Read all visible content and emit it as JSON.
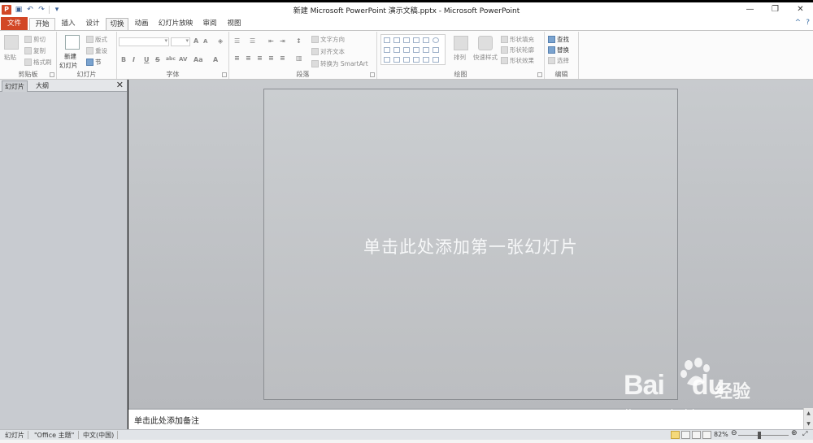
{
  "app": {
    "title": "新建 Microsoft PowerPoint 演示文稿.pptx - Microsoft PowerPoint",
    "icon_letter": "P"
  },
  "window_controls": {
    "minimize": "—",
    "maximize": "❐",
    "close": "✕"
  },
  "quick_access": {
    "save_icon": "save-icon",
    "undo_icon": "undo-icon",
    "redo_icon": "redo-icon"
  },
  "tabs": [
    "文件",
    "开始",
    "插入",
    "设计",
    "切换",
    "动画",
    "幻灯片放映",
    "审阅",
    "视图"
  ],
  "ribbon": {
    "clipboard": {
      "label": "剪贴板",
      "paste": "粘贴",
      "cut": "剪切",
      "copy": "复制",
      "format_painter": "格式刷"
    },
    "slides": {
      "label": "幻灯片",
      "new_slide_1": "新建",
      "new_slide_2": "幻灯片",
      "layout": "版式",
      "reset": "重设",
      "section": "节"
    },
    "font": {
      "label": "字体",
      "bold": "B",
      "italic": "I",
      "underline": "U",
      "strike": "S",
      "shadow": "abc",
      "spacing": "AV",
      "case": "Aa",
      "color": "A",
      "grow": "A",
      "shrink": "A"
    },
    "paragraph": {
      "label": "段落",
      "text_direction": "文字方向",
      "align_text": "对齐文本",
      "smartart": "转换为 SmartArt"
    },
    "drawing": {
      "label": "绘图",
      "arrange": "排列",
      "quick_styles": "快速样式",
      "shape_fill": "形状填充",
      "shape_outline": "形状轮廓",
      "shape_effects": "形状效果"
    },
    "editing": {
      "label": "编辑",
      "find": "查找",
      "replace": "替换",
      "select": "选择"
    }
  },
  "left_panel": {
    "tabs": [
      "幻灯片",
      "大纲"
    ],
    "close": "✕"
  },
  "slide": {
    "placeholder": "单击此处添加第一张幻灯片"
  },
  "notes": {
    "placeholder": "单击此处添加备注"
  },
  "status": {
    "slide": "幻灯片",
    "theme": "\"Office 主题\"",
    "language": "中文(中国)",
    "zoom": "82%"
  },
  "watermark": {
    "logo": "Bai",
    "logo_du": "du",
    "brand": "经验",
    "url": "jingyan.baidu.com"
  },
  "colors": {
    "file_tab": "#d24726",
    "accent": "#3a6ea5",
    "workspace": "#c0c3c7"
  }
}
